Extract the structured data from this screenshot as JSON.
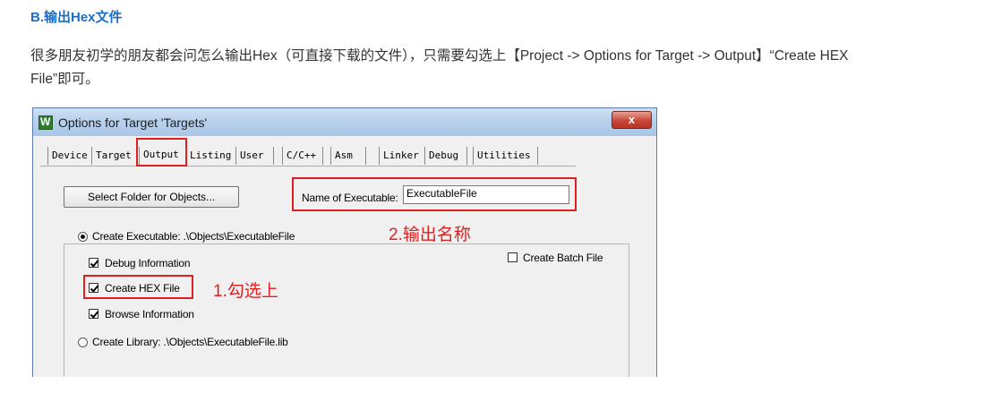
{
  "article": {
    "heading": "B.输出Hex文件",
    "paragraph_line1": "很多朋友初学的朋友都会问怎么输出Hex（可直接下载的文件），只需要勾选上【Project -> Options for Target -> Output】“Create HEX",
    "paragraph_line2": "File”即可。"
  },
  "dialog": {
    "title": "Options for Target 'Targets'",
    "close_label": "x",
    "tabs": [
      "Device",
      "Target",
      "Output",
      "Listing",
      "User",
      "C/C++",
      "Asm",
      "Linker",
      "Debug",
      "Utilities"
    ],
    "active_tab": "Output",
    "select_folder_label": "Select Folder for Objects...",
    "name_of_executable_label": "Name of Executable:",
    "name_of_executable_value": "ExecutableFile",
    "create_executable_label": "Create Executable:  .\\Objects\\ExecutableFile",
    "debug_info_label": "Debug Information",
    "create_hex_label": "Create HEX File",
    "browse_info_label": "Browse Information",
    "create_library_label": "Create Library:  .\\Objects\\ExecutableFile.lib",
    "create_batch_label": "Create Batch File",
    "checkboxes": {
      "debug_info": true,
      "create_hex": true,
      "browse_info": true,
      "create_batch": false
    },
    "output_mode": "executable"
  },
  "annotations": {
    "step1": "1.勾选上",
    "step2": "2.输出名称"
  },
  "colors": {
    "heading": "#1a6fc4",
    "annotation": "#e02020"
  }
}
